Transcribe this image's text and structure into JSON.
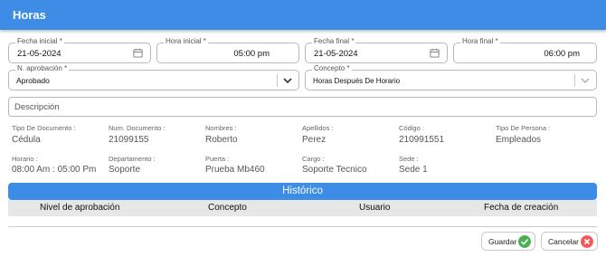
{
  "header": {
    "title": "Horas"
  },
  "form": {
    "fecha_inicial": {
      "label": "Fecha inicial *",
      "value": "21-05-2024"
    },
    "hora_inicial": {
      "label": "Hora inicial *",
      "value": "05:00 pm"
    },
    "fecha_final": {
      "label": "Fecha final *",
      "value": "21-05-2024"
    },
    "hora_final": {
      "label": "Hora final *",
      "value": "06:00 pm"
    },
    "aprobacion": {
      "label": "N. aprobación *",
      "value": "Aprobado"
    },
    "concepto": {
      "label": "Concepto *",
      "value": "Horas Después De Horario"
    },
    "descripcion": {
      "placeholder": "Descripción"
    }
  },
  "info": {
    "tipo_documento": {
      "label": "Tipo De Documento :",
      "value": "Cédula"
    },
    "num_documento": {
      "label": "Num. Documento :",
      "value": "21099155"
    },
    "nombres": {
      "label": "Nombres :",
      "value": "Roberto"
    },
    "apellidos": {
      "label": "Apellidos :",
      "value": "Perez"
    },
    "codigo": {
      "label": "Código :",
      "value": "210991551"
    },
    "tipo_persona": {
      "label": "Tipo De Persona :",
      "value": "Empleados"
    },
    "horario": {
      "label": "Horario :",
      "value": "08:00 Am : 05:00 Pm"
    },
    "departamento": {
      "label": "Departamento :",
      "value": "Soporte"
    },
    "puerta": {
      "label": "Puerta :",
      "value": "Prueba Mb460"
    },
    "cargo": {
      "label": "Cargo :",
      "value": "Soporte Tecnico"
    },
    "sede": {
      "label": "Sede :",
      "value": "Sede 1"
    }
  },
  "historico": {
    "title": "Histórico",
    "columns": [
      "Nivel de aprobación",
      "Concepto",
      "Usuario",
      "Fecha de creación"
    ],
    "rows": []
  },
  "buttons": {
    "guardar": "Guardar",
    "cancelar": "Cancelar"
  },
  "colors": {
    "accent": "#3d8ce6",
    "save_icon": "#4caf50",
    "cancel_icon": "#f05a5a"
  },
  "icons": {
    "calendar": "calendar-icon",
    "chevron": "chevron-down-icon",
    "save": "check-circle-icon",
    "cancel": "close-circle-icon"
  }
}
